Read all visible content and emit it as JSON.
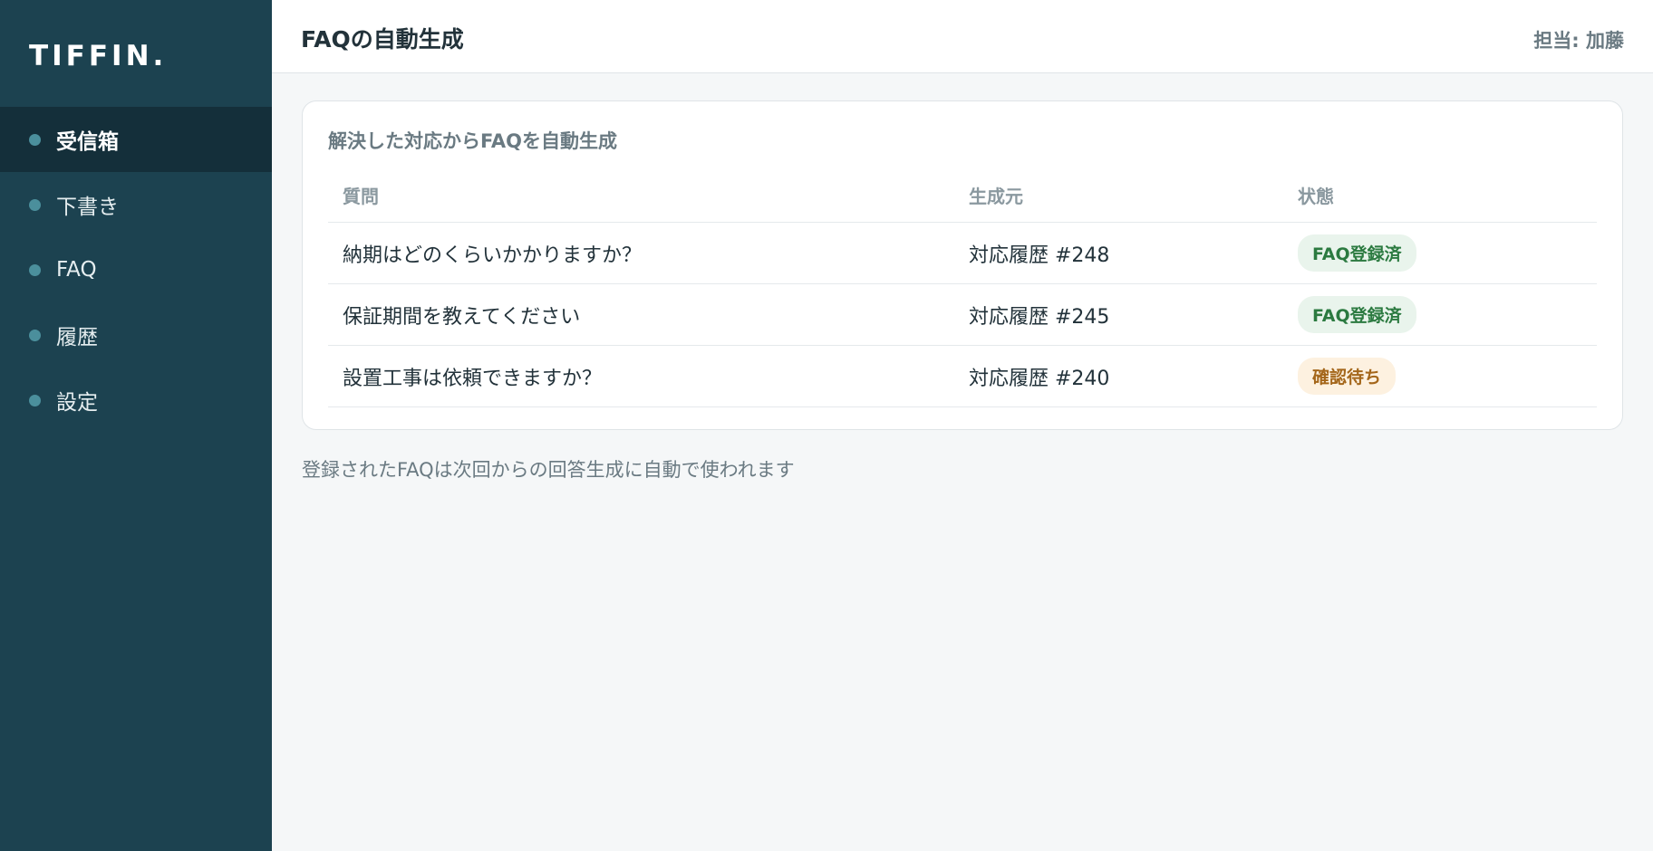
{
  "app": {
    "logo": "TIFFIN."
  },
  "sidebar": {
    "items": [
      {
        "label": "受信箱",
        "active": true
      },
      {
        "label": "下書き",
        "active": false
      },
      {
        "label": "FAQ",
        "active": false
      },
      {
        "label": "履歴",
        "active": false
      },
      {
        "label": "設定",
        "active": false
      }
    ]
  },
  "header": {
    "title": "FAQの自動生成",
    "assignee": "担当: 加藤"
  },
  "card": {
    "title": "解決した対応からFAQを自動生成",
    "columns": [
      "質問",
      "生成元",
      "状態"
    ],
    "rows": [
      {
        "question": "納期はどのくらいかかりますか？",
        "source": "対応履歴 #248",
        "status": "FAQ登録済",
        "status_type": "done"
      },
      {
        "question": "保証期間を教えてください",
        "source": "対応履歴 #245",
        "status": "FAQ登録済",
        "status_type": "done"
      },
      {
        "question": "設置工事は依頼できますか？",
        "source": "対応履歴 #240",
        "status": "確認待ち",
        "status_type": "pending"
      }
    ]
  },
  "footnote": "登録されたFAQは次回からの回答生成に自動で使われます",
  "colors": {
    "sidebar_bg": "#1c4250",
    "sidebar_active_bg": "#142f3a",
    "nav_dot": "#4b8f9c",
    "badge_done_bg": "#e9f4ec",
    "badge_done_text": "#2b7a40",
    "badge_pending_bg": "#fdf1e0",
    "badge_pending_text": "#a4661a"
  }
}
